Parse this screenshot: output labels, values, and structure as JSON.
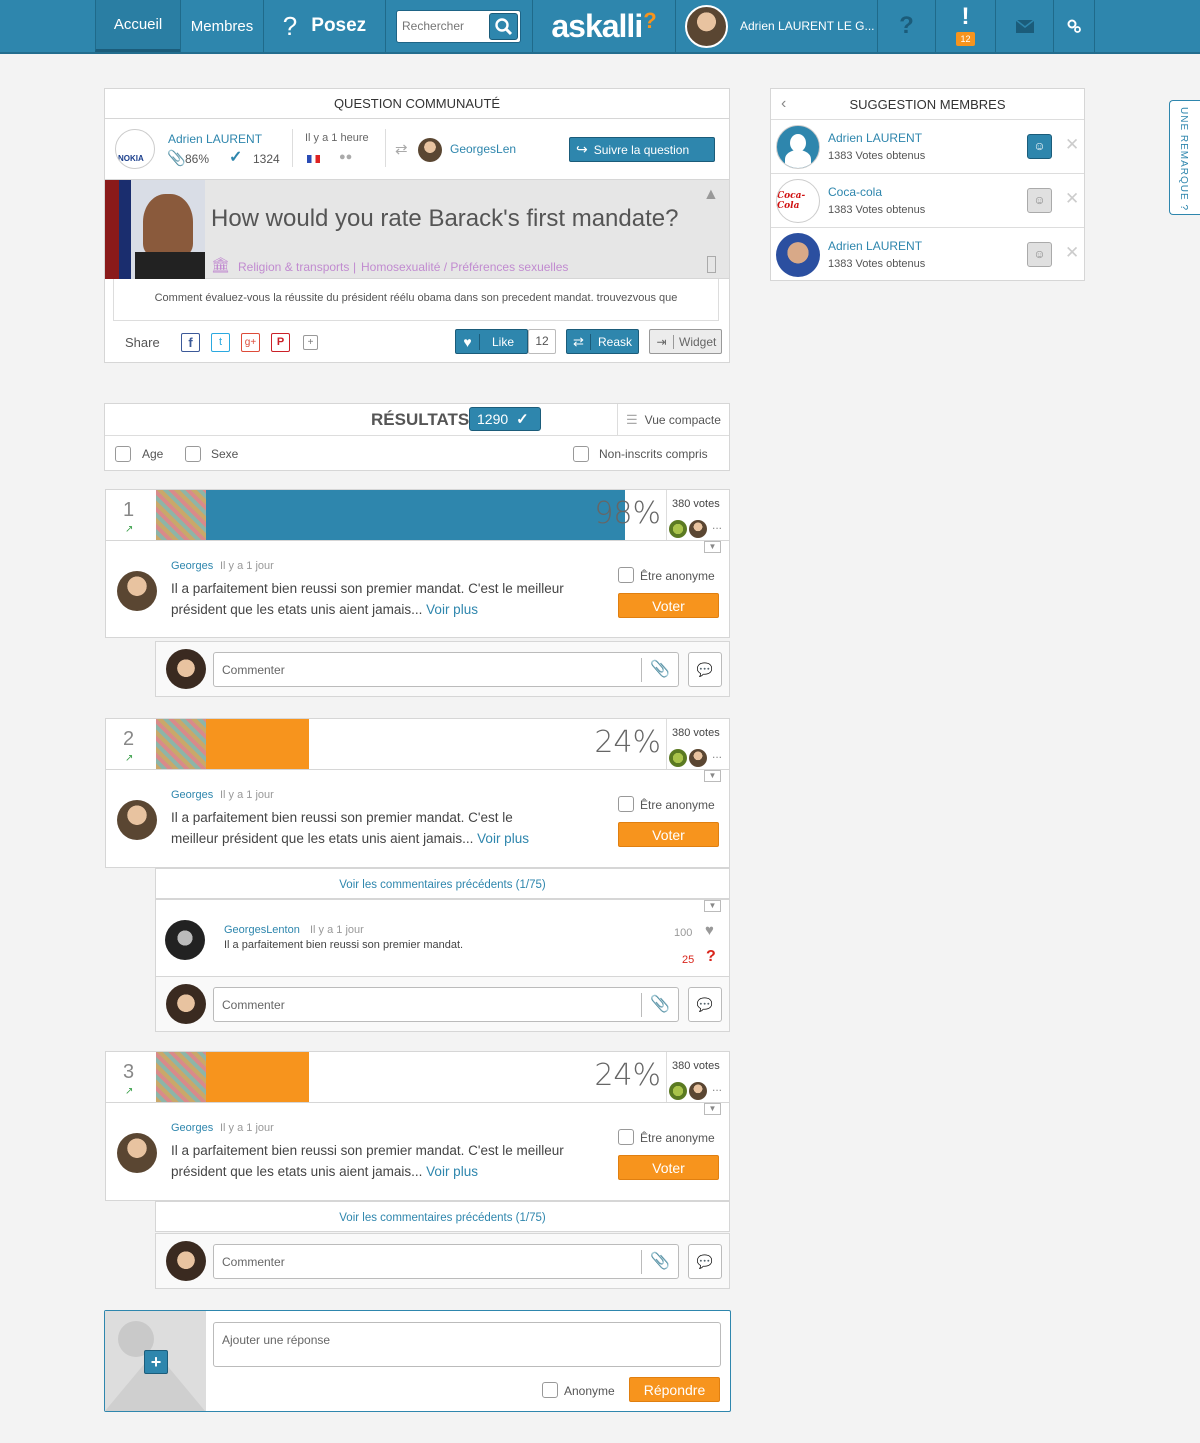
{
  "nav": {
    "home": "Accueil",
    "members": "Membres",
    "ask": "Posez",
    "search_placeholder": "Rechercher",
    "logo": "askalli",
    "user_name": "Adrien LAURENT LE G...",
    "help": "?",
    "alerts_badge": "12",
    "colors": {
      "bar": "#2e86ad",
      "accent": "#f7941d"
    }
  },
  "question": {
    "header": "QUESTION COMMUNAUTÉ",
    "author": "Adrien LAURENT",
    "author_logo_text": "NOKIA",
    "stat_percent": "86%",
    "stat_count": "1324",
    "time": "Il y a 1 heure",
    "reasker": "GeorgesLen",
    "follow_btn": "Suivre la question",
    "title": "How would you rate Barack's first mandate?",
    "category_1": "Religion & transports",
    "category_sep": "|",
    "category_2": "Homosexualité / Préférences sexuelles",
    "description": "Comment évaluez-vous la réussite du président réélu obama dans son precedent mandat. trouvezvous que",
    "share_label": "Share",
    "like_label": "Like",
    "like_count": "12",
    "reask_label": "Reask",
    "widget_label": "Widget"
  },
  "results": {
    "title": "RÉSULTATS",
    "count": "1290",
    "compact_view": "Vue compacte",
    "filter_age": "Age",
    "filter_sex": "Sexe",
    "filter_unregistered": "Non-inscrits compris"
  },
  "answers": [
    {
      "rank": "1",
      "percent_label": "98%",
      "percent": 98,
      "votes": "380 votes",
      "more": "...",
      "bar_color": "#2e86ad",
      "author": "Georges",
      "time": "Il y a 1 jour",
      "text": "Il a parfaitement bien reussi son premier mandat. C'est le meilleur président que les etats unis aient jamais...",
      "more_link": "Voir plus",
      "anonymous": "Être anonyme",
      "vote_btn": "Voter",
      "comment_placeholder": "Commenter"
    },
    {
      "rank": "2",
      "percent_label": "24%",
      "percent": 24,
      "votes": "380 votes",
      "more": "...",
      "bar_color": "#f7941d",
      "author": "Georges",
      "time": "Il y a 1 jour",
      "text": "Il a parfaitement bien reussi son premier mandat. C'est le meilleur président que les etats unis aient jamais...",
      "more_link": "Voir plus",
      "anonymous": "Être anonyme",
      "vote_btn": "Voter",
      "prev_comments": "Voir les commentaires précédents (1/75)",
      "comment": {
        "author": "GeorgesLenton",
        "time": "Il y a 1 jour",
        "text": "Il a parfaitement bien reussi son premier mandat.",
        "likes": "100",
        "dislikes": "25"
      },
      "comment_placeholder": "Commenter"
    },
    {
      "rank": "3",
      "percent_label": "24%",
      "percent": 24,
      "votes": "380 votes",
      "more": "...",
      "bar_color": "#f7941d",
      "author": "Georges",
      "time": "Il y a 1 jour",
      "text": "Il a parfaitement bien reussi son premier mandat. C'est le meilleur président que les etats unis aient jamais...",
      "more_link": "Voir plus",
      "anonymous": "Être anonyme",
      "vote_btn": "Voter",
      "prev_comments": "Voir les commentaires précédents (1/75)",
      "comment_placeholder": "Commenter"
    }
  ],
  "reply": {
    "placeholder": "Ajouter une réponse",
    "anonymous": "Anonyme",
    "submit": "Répondre"
  },
  "suggestions": {
    "header": "SUGGESTION MEMBRES",
    "items": [
      {
        "name": "Adrien LAURENT",
        "votes": "1383 Votes obtenus"
      },
      {
        "name": "Coca-cola",
        "votes": "1383 Votes obtenus",
        "logo_text": "Coca-Cola"
      },
      {
        "name": "Adrien LAURENT",
        "votes": "1383 Votes obtenus"
      }
    ]
  },
  "feedback_tab": "UNE REMARQUE ?"
}
